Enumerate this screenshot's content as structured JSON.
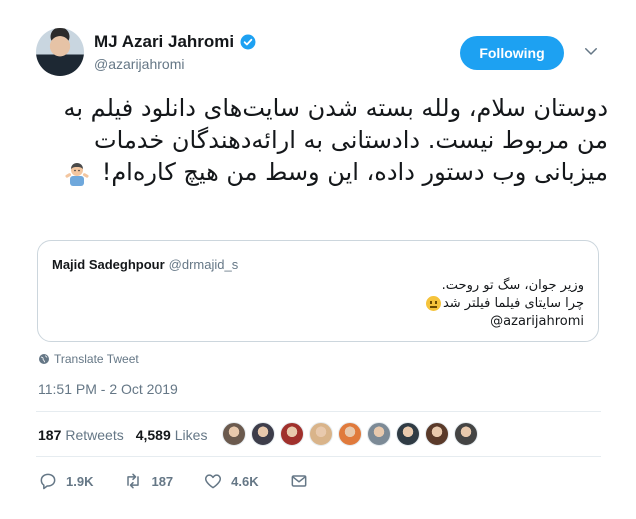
{
  "author": {
    "display_name": "MJ Azari Jahromi",
    "handle": "@azarijahromi",
    "follow_label": "Following"
  },
  "tweet": {
    "text": "دوستان سلام، ولله بسته شدن سایت‌های دانلود فیلم به من مربوط نیست. دادستانی به ارائه‌دهندگان خدمات میزبانی وب دستور داده، این وسط من هیچ کاره‌ام!"
  },
  "quote": {
    "name": "Majid Sadeghpour",
    "handle": "@drmajid_s",
    "line1": "وزیر جوان، سگ تو روحت.",
    "line2": "چرا سایتای فیلما فیلتر شد",
    "line3": "@azarijahromi"
  },
  "translate_label": "Translate Tweet",
  "timestamp": "11:51 PM - 2 Oct 2019",
  "stats": {
    "retweets_count": "187",
    "retweets_label": "Retweets",
    "likes_count": "4,589",
    "likes_label": "Likes"
  },
  "likers": [
    "#6b5a4e",
    "#3d3d4a",
    "#a0302c",
    "#d9b48a",
    "#e07a3c",
    "#7c8a96",
    "#2f3b44",
    "#5a3a2a",
    "#444444"
  ],
  "actions": {
    "reply_count": "1.9K",
    "retweet_count": "187",
    "like_count": "4.6K"
  },
  "colors": {
    "accent": "#1da1f2",
    "muted": "#657786",
    "border": "#ccd6dd"
  }
}
